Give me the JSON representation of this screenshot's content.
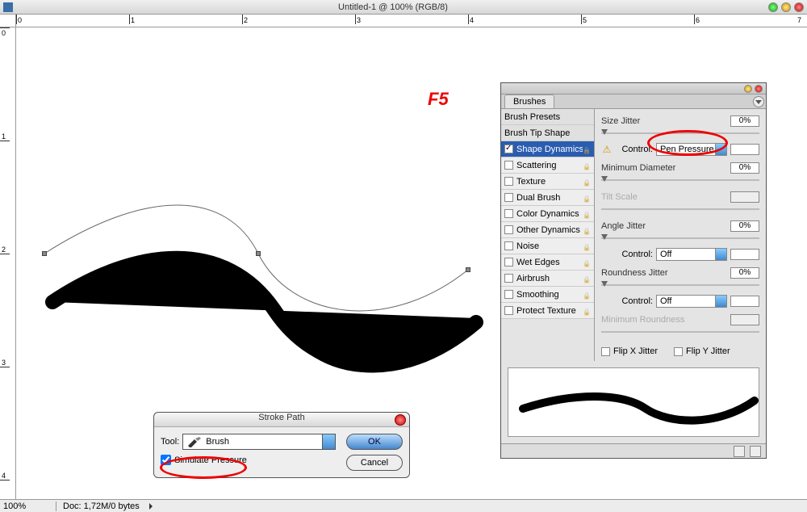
{
  "title": "Untitled-1 @ 100% (RGB/8)",
  "annotation_f5": "F5",
  "status": {
    "zoom": "100%",
    "doc": "Doc: 1,72M/0 bytes"
  },
  "ruler_top": [
    "0",
    "1",
    "2",
    "3",
    "4",
    "5",
    "6",
    "7"
  ],
  "ruler_left": [
    "0",
    "1",
    "2",
    "3",
    "4"
  ],
  "stroke_path": {
    "title": "Stroke Path",
    "tool_label": "Tool:",
    "tool_value": "Brush",
    "simulate_pressure": "Simulate Pressure",
    "simulate_checked": true,
    "ok": "OK",
    "cancel": "Cancel"
  },
  "brushes": {
    "tab": "Brushes",
    "presets": "Brush Presets",
    "tip_shape": "Brush Tip Shape",
    "options": [
      {
        "label": "Shape Dynamics",
        "checked": true,
        "selected": true
      },
      {
        "label": "Scattering",
        "checked": false
      },
      {
        "label": "Texture",
        "checked": false
      },
      {
        "label": "Dual Brush",
        "checked": false
      },
      {
        "label": "Color Dynamics",
        "checked": false
      },
      {
        "label": "Other Dynamics",
        "checked": false
      },
      {
        "label": "Noise",
        "checked": false
      },
      {
        "label": "Wet Edges",
        "checked": false
      },
      {
        "label": "Airbrush",
        "checked": false
      },
      {
        "label": "Smoothing",
        "checked": false
      },
      {
        "label": "Protect Texture",
        "checked": false
      }
    ],
    "right": {
      "size_jitter": "Size Jitter",
      "size_jitter_val": "0%",
      "control_label": "Control:",
      "control_value": "Pen Pressure",
      "min_diameter": "Minimum Diameter",
      "min_diameter_val": "0%",
      "tilt_scale": "Tilt Scale",
      "angle_jitter": "Angle Jitter",
      "angle_jitter_val": "0%",
      "angle_control_val": "Off",
      "roundness_jitter": "Roundness Jitter",
      "roundness_jitter_val": "0%",
      "roundness_control_val": "Off",
      "min_roundness": "Minimum Roundness",
      "flip_x": "Flip X Jitter",
      "flip_y": "Flip Y Jitter"
    }
  }
}
